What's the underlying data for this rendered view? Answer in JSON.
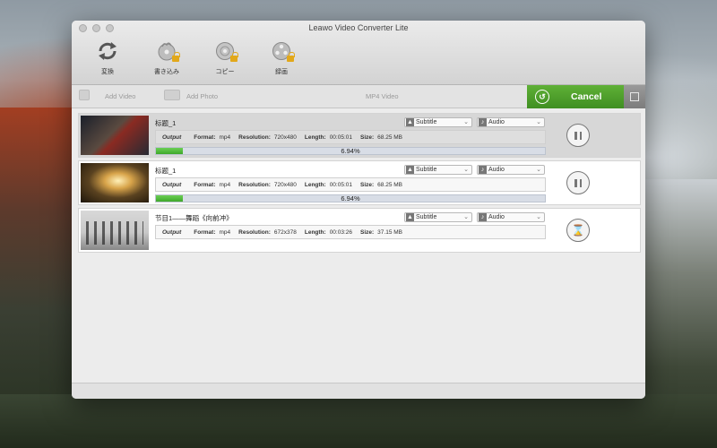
{
  "window": {
    "title": "Leawo Video Converter Lite"
  },
  "toolbar": {
    "convert_label": "変換",
    "burn_label": "書き込み",
    "copy_label": "コピー",
    "record_label": "録画"
  },
  "subbar": {
    "add_video_label": "Add Video",
    "add_photo_label": "Add Photo",
    "profile_label": "MP4 Video",
    "cancel_label": "Cancel"
  },
  "items": [
    {
      "title": "标题_1",
      "subtitle_label": "Subtitle",
      "audio_label": "Audio",
      "output_label": "Output",
      "format_label": "Format:",
      "format_value": "mp4",
      "resolution_label": "Resolution:",
      "resolution_value": "720x480",
      "length_label": "Length:",
      "length_value": "00:05:01",
      "size_label": "Size:",
      "size_value": "68.25 MB",
      "progress_text": "6.94%",
      "progress_fraction": 0.0694,
      "action": "pause"
    },
    {
      "title": "标题_1",
      "subtitle_label": "Subtitle",
      "audio_label": "Audio",
      "output_label": "Output",
      "format_label": "Format:",
      "format_value": "mp4",
      "resolution_label": "Resolution:",
      "resolution_value": "720x480",
      "length_label": "Length:",
      "length_value": "00:05:01",
      "size_label": "Size:",
      "size_value": "68.25 MB",
      "progress_text": "6.94%",
      "progress_fraction": 0.0694,
      "action": "pause"
    },
    {
      "title": "节目1——舞蹈《向前冲》",
      "subtitle_label": "Subtitle",
      "audio_label": "Audio",
      "output_label": "Output",
      "format_label": "Format:",
      "format_value": "mp4",
      "resolution_label": "Resolution:",
      "resolution_value": "672x378",
      "length_label": "Length:",
      "length_value": "00:03:26",
      "size_label": "Size:",
      "size_value": "37.15 MB",
      "action": "waiting"
    }
  ],
  "colors": {
    "cancel_green": "#4fa02c",
    "progress_green": "#4cba36"
  },
  "icons": {
    "convert": "refresh-icon",
    "burn": "disc-burn-icon",
    "copy": "disc-copy-icon",
    "record": "film-reel-icon",
    "pause": "pause-icon",
    "waiting": "hourglass-icon"
  }
}
